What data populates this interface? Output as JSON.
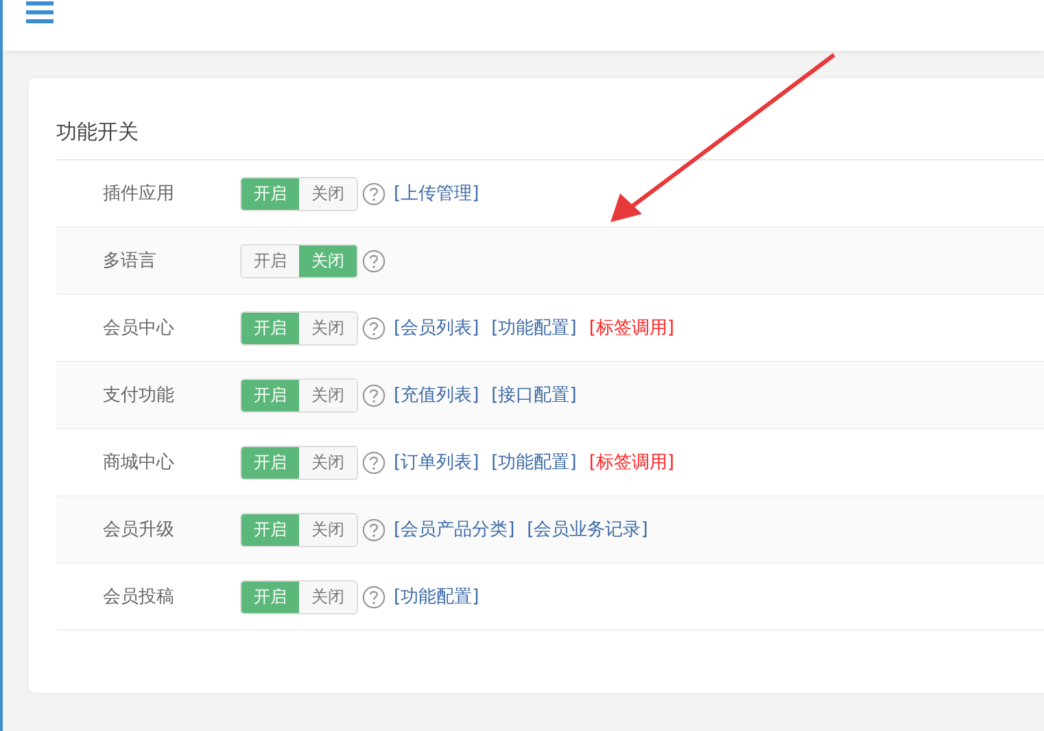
{
  "panel": {
    "title": "功能开关"
  },
  "rows": [
    {
      "label": "插件应用",
      "on_label": "开启",
      "off_label": "关闭",
      "on": true,
      "links": [
        {
          "text": "[上传管理]",
          "color": "#3d6aa8"
        }
      ]
    },
    {
      "label": "多语言",
      "on_label": "开启",
      "off_label": "关闭",
      "on": false,
      "links": []
    },
    {
      "label": "会员中心",
      "on_label": "开启",
      "off_label": "关闭",
      "on": true,
      "links": [
        {
          "text": "[会员列表]",
          "color": "#3d6aa8"
        },
        {
          "text": "[功能配置]",
          "color": "#3d6aa8"
        },
        {
          "text": "[标签调用]",
          "color": "#ff2222"
        }
      ]
    },
    {
      "label": "支付功能",
      "on_label": "开启",
      "off_label": "关闭",
      "on": true,
      "links": [
        {
          "text": "[充值列表]",
          "color": "#3d6aa8"
        },
        {
          "text": "[接口配置]",
          "color": "#3d6aa8"
        }
      ]
    },
    {
      "label": "商城中心",
      "on_label": "开启",
      "off_label": "关闭",
      "on": true,
      "links": [
        {
          "text": "[订单列表]",
          "color": "#3d6aa8"
        },
        {
          "text": "[功能配置]",
          "color": "#3d6aa8"
        },
        {
          "text": "[标签调用]",
          "color": "#ff2222"
        }
      ]
    },
    {
      "label": "会员升级",
      "on_label": "开启",
      "off_label": "关闭",
      "on": true,
      "links": [
        {
          "text": "[会员产品分类]",
          "color": "#3d6aa8"
        },
        {
          "text": "[会员业务记录]",
          "color": "#3d6aa8"
        }
      ]
    },
    {
      "label": "会员投稿",
      "on_label": "开启",
      "off_label": "关闭",
      "on": true,
      "links": [
        {
          "text": "[功能配置]",
          "color": "#3d6aa8"
        }
      ]
    }
  ]
}
